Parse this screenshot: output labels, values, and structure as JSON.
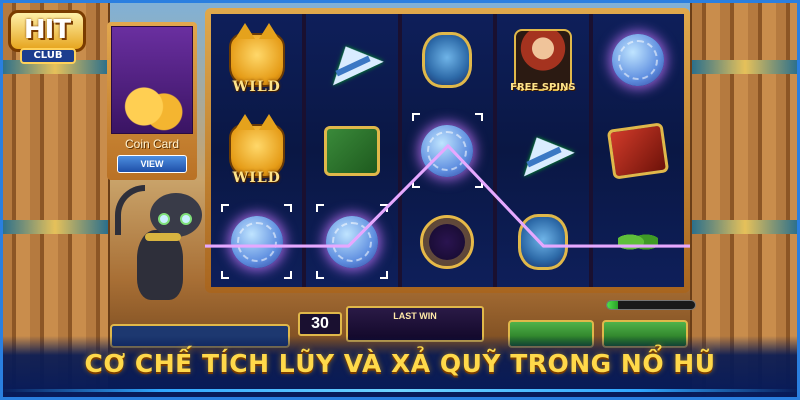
{
  "logo": {
    "badge": "HIT",
    "club": "CLUB"
  },
  "coin_card": {
    "title": "Coin Card",
    "view_label": "VIEW"
  },
  "reels": [
    [
      {
        "symbol": "cat-wild-icon",
        "label": "WILD"
      },
      {
        "symbol": "cat-wild-icon",
        "label": "WILD"
      },
      {
        "symbol": "yarn-ball-icon",
        "label": "",
        "win": true
      }
    ],
    [
      {
        "symbol": "paper-plane-icon",
        "label": ""
      },
      {
        "symbol": "mouse-tile-icon",
        "label": ""
      },
      {
        "symbol": "yarn-ball-icon",
        "label": "",
        "win": true
      }
    ],
    [
      {
        "symbol": "scarab-icon",
        "label": ""
      },
      {
        "symbol": "yarn-ball-icon",
        "label": "",
        "win": true
      },
      {
        "symbol": "orb-icon",
        "label": ""
      }
    ],
    [
      {
        "symbol": "woman-free-spins-icon",
        "label": "FREE SPINS"
      },
      {
        "symbol": "paper-plane-icon",
        "label": ""
      },
      {
        "symbol": "scarab-icon",
        "label": ""
      }
    ],
    [
      {
        "symbol": "yarn-ball-icon",
        "label": ""
      },
      {
        "symbol": "snake-tile-icon",
        "label": ""
      },
      {
        "symbol": "leaves-icon",
        "label": ""
      }
    ]
  ],
  "controls": {
    "bet_value": "30",
    "last_win_label": "LAST WIN",
    "progress_fraction": 0.12
  },
  "banner": {
    "text": "CƠ CHẾ TÍCH LŨY VÀ XẢ QUỸ TRONG NỔ HŨ"
  },
  "colors": {
    "win_line": "#e6a8ff",
    "banner_text": "#ffd94a",
    "frame": "#2a7fe0"
  }
}
